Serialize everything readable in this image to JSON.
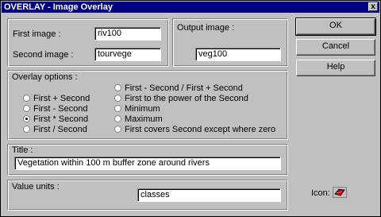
{
  "window": {
    "title": "OVERLAY - Image Overlay",
    "close_glyph": "x"
  },
  "images": {
    "first_label": "First image :",
    "first_value": "riv100",
    "second_label": "Second image :",
    "second_value": "tourvege"
  },
  "output": {
    "label": "Output image :",
    "value": "veg100"
  },
  "buttons": {
    "ok": "OK",
    "cancel": "Cancel",
    "help": "Help"
  },
  "options": {
    "label": "Overlay options :",
    "left": [
      "First + Second",
      "First - Second",
      "First * Second",
      "First / Second"
    ],
    "right": [
      "First - Second / First + Second",
      "First to the power of the Second",
      "Minimum",
      "Maximum",
      "First covers Second except where zero"
    ],
    "selected": "First * Second"
  },
  "title_section": {
    "label": "Title :",
    "value": "Vegetation within 100 m buffer zone around rivers"
  },
  "value_units": {
    "label": "Value units :",
    "value": "classes"
  },
  "icon_section": {
    "label": "Icon:",
    "icon_name": "palette-icon",
    "icon_color": "#c00000"
  }
}
